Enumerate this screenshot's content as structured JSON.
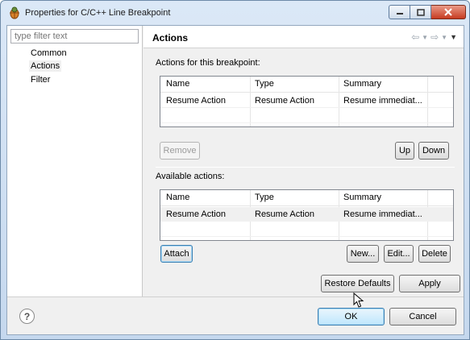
{
  "window": {
    "title": "Properties for C/C++ Line Breakpoint",
    "icon": "bug-icon",
    "controls": {
      "minimize": "minimize-icon",
      "maximize": "maximize-icon",
      "close": "close-icon"
    }
  },
  "left": {
    "filter_placeholder": "type filter text",
    "filter_value": "",
    "items": [
      {
        "label": "Common",
        "selected": false
      },
      {
        "label": "Actions",
        "selected": true
      },
      {
        "label": "Filter",
        "selected": false
      }
    ]
  },
  "page": {
    "title": "Actions",
    "nav_icons": [
      "back-arrow-icon",
      "dropdown-icon",
      "forward-arrow-icon",
      "dropdown-icon",
      "view-menu-icon"
    ]
  },
  "breakpoint_actions": {
    "label": "Actions for this breakpoint:",
    "columns": [
      "Name",
      "Type",
      "Summary"
    ],
    "rows": [
      {
        "name": "Resume Action",
        "type": "Resume Action",
        "summary": "Resume immediat..."
      }
    ],
    "remove_label": "Remove",
    "up_label": "Up",
    "down_label": "Down"
  },
  "available_actions": {
    "label": "Available actions:",
    "columns": [
      "Name",
      "Type",
      "Summary"
    ],
    "rows": [
      {
        "name": "Resume Action",
        "type": "Resume Action",
        "summary": "Resume immediat..."
      }
    ],
    "attach_label": "Attach",
    "new_label": "New...",
    "edit_label": "Edit...",
    "delete_label": "Delete"
  },
  "page_buttons": {
    "restore_label": "Restore Defaults",
    "apply_label": "Apply"
  },
  "dialog_buttons": {
    "help_icon": "help-icon",
    "ok_label": "OK",
    "cancel_label": "Cancel"
  },
  "colors": {
    "titlebar": "#c5d8ee",
    "close_button": "#c73b21",
    "ok_button": "#bee6fd",
    "selection": "#f0f0f0"
  }
}
